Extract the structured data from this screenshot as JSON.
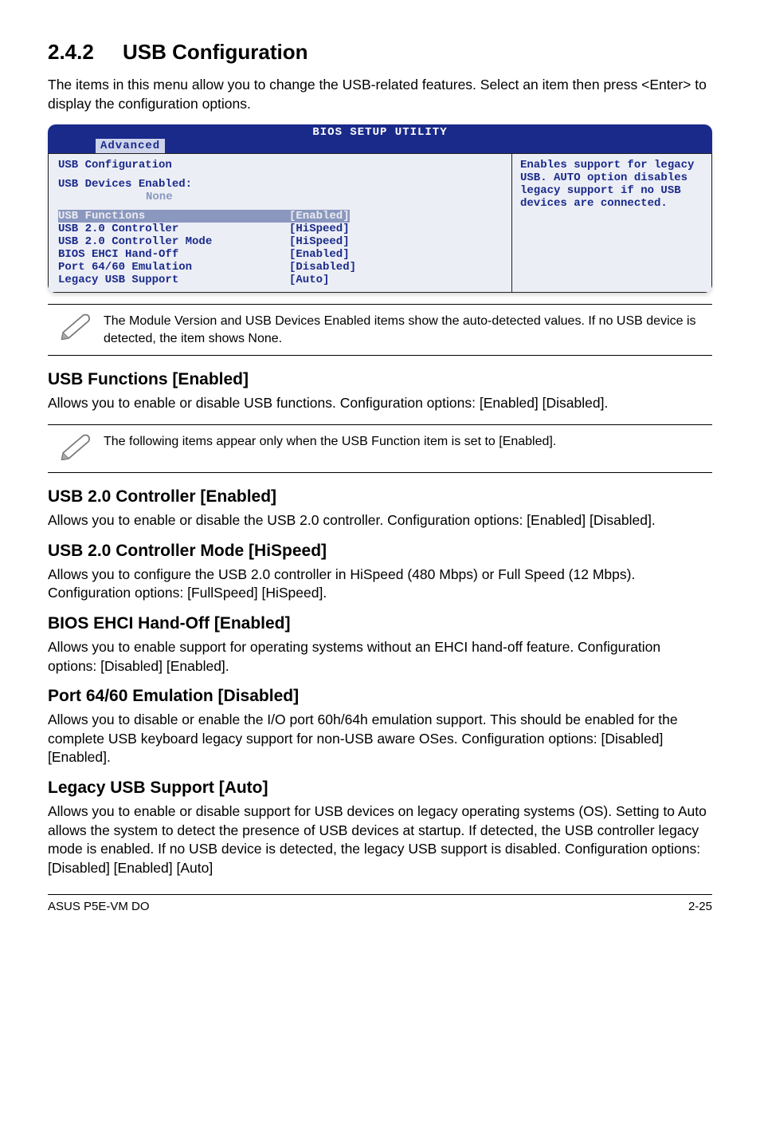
{
  "section": {
    "number": "2.4.2",
    "title": "USB Configuration",
    "intro": "The items in this menu allow you to change the USB-related features. Select an item then press <Enter> to display the configuration options."
  },
  "bios": {
    "bar_title": "BIOS SETUP UTILITY",
    "tab": "Advanced",
    "left": {
      "heading": "USB Configuration",
      "devices_label": "USB Devices Enabled:",
      "devices_value": "None",
      "rows": [
        {
          "label": "USB Functions",
          "value": "[Enabled]",
          "selected": true
        },
        {
          "label": "USB 2.0 Controller",
          "value": "[HiSpeed]",
          "selected": false
        },
        {
          "label": "USB 2.0 Controller Mode",
          "value": "[HiSpeed]",
          "selected": false
        },
        {
          "label": "BIOS EHCI Hand-Off",
          "value": "[Enabled]",
          "selected": false
        },
        {
          "label": "Port 64/60 Emulation",
          "value": "[Disabled]",
          "selected": false
        },
        {
          "label": "Legacy USB Support",
          "value": "[Auto]",
          "selected": false
        }
      ]
    },
    "right": "Enables support for legacy USB. AUTO option disables legacy support if no USB devices are connected."
  },
  "note1": "The Module Version and USB Devices Enabled items show the auto-detected values. If no USB device is detected, the item shows None.",
  "h_usb_functions": "USB Functions [Enabled]",
  "p_usb_functions": "Allows you to enable or disable USB functions. Configuration options: [Enabled] [Disabled].",
  "note2": "The following items appear only when the USB Function item is set to [Enabled].",
  "h_usb20": "USB 2.0 Controller [Enabled]",
  "p_usb20": "Allows you to enable or disable the USB  2.0 controller. Configuration options: [Enabled] [Disabled].",
  "h_usb20mode": "USB 2.0 Controller Mode [HiSpeed]",
  "p_usb20mode": "Allows you to configure the USB 2.0 controller in HiSpeed (480 Mbps) or Full Speed (12 Mbps). Configuration options: [FullSpeed] [HiSpeed].",
  "h_ehci": "BIOS EHCI Hand-Off [Enabled]",
  "p_ehci": "Allows you to enable support for operating systems without an EHCI hand-off feature. Configuration options: [Disabled] [Enabled].",
  "h_port": "Port 64/60 Emulation [Disabled]",
  "p_port": "Allows you to disable or enable the I/O port 60h/64h emulation support. This should be enabled for the complete USB keyboard legacy support for non-USB aware OSes. Configuration options: [Disabled] [Enabled].",
  "h_legacy": "Legacy USB Support [Auto]",
  "p_legacy": "Allows you to enable or disable support for USB devices on legacy operating systems (OS). Setting to Auto allows the system to detect the presence of USB devices at startup. If detected, the USB controller legacy mode is enabled. If no USB device is detected, the legacy USB support is disabled. Configuration options: [Disabled] [Enabled] [Auto]",
  "footer": {
    "left": "ASUS P5E-VM DO",
    "right": "2-25"
  }
}
